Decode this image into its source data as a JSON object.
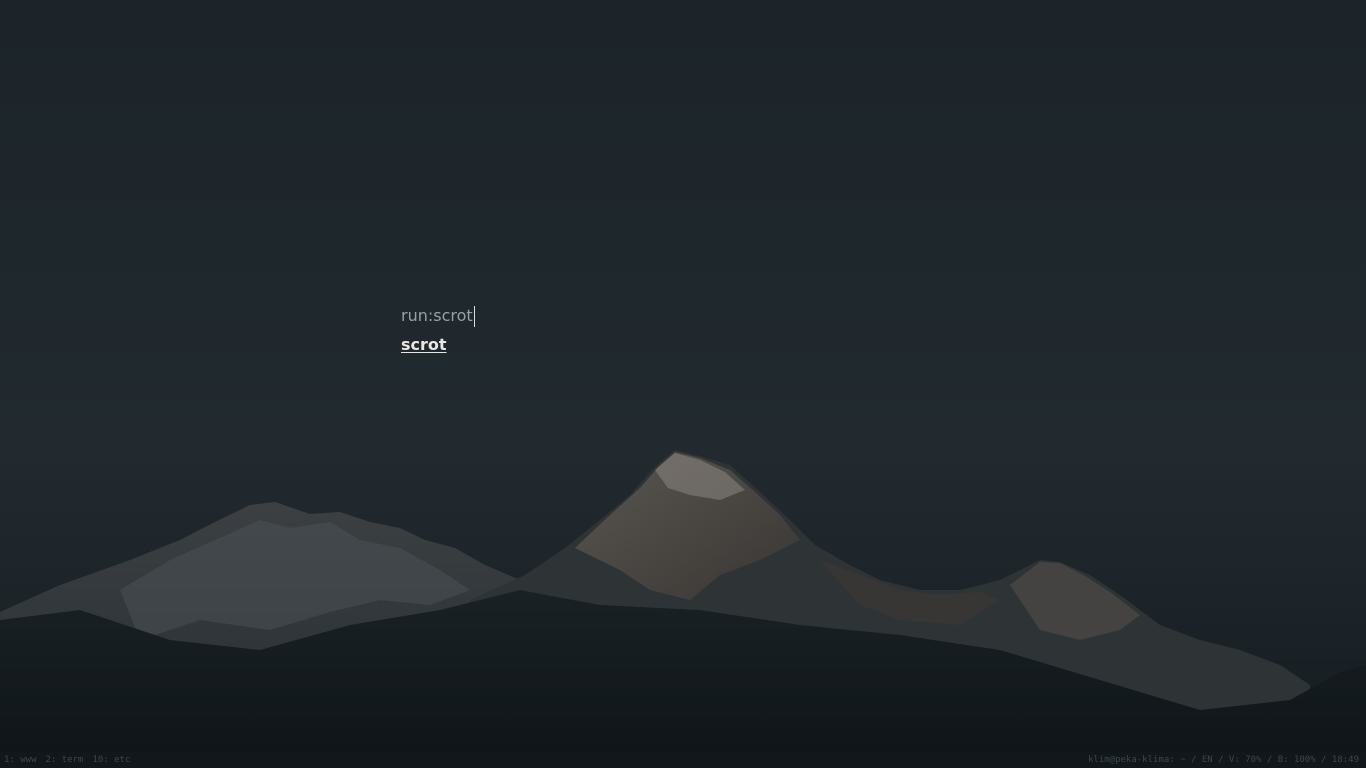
{
  "launcher": {
    "prompt": "run:",
    "query": "scrot",
    "results": [
      "scrot"
    ]
  },
  "statusbar": {
    "workspaces": [
      "1: www",
      "2: term",
      "10: etc"
    ],
    "user_host": "klim@peka-klima",
    "cwd": "~",
    "layout": "EN",
    "volume": "V: 70%",
    "brightness": "B: 100%",
    "clock": "18:49"
  }
}
